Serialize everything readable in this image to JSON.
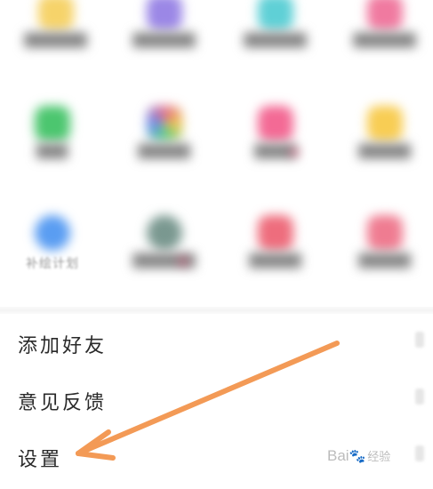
{
  "grid": {
    "tiles": [
      {
        "label": "",
        "color": "#f6d36a"
      },
      {
        "label": "",
        "color": "#9b87e6"
      },
      {
        "label": "",
        "color": "#5fd0d6"
      },
      {
        "label": "",
        "color": "#f07aa0"
      },
      {
        "label": "",
        "color": "#4cc66f"
      },
      {
        "label": "",
        "color": "#e36b8d"
      },
      {
        "label": "",
        "color": "#f36a95"
      },
      {
        "label": "",
        "color": "#f8cd54"
      },
      {
        "label": "补绘计划",
        "color": "#5a9df2"
      },
      {
        "label": "",
        "color": "#7a9890"
      },
      {
        "label": "",
        "color": "#ee6d7d"
      },
      {
        "label": "",
        "color": "#ef7c91"
      }
    ]
  },
  "menu": {
    "items": [
      {
        "label": "添加好友"
      },
      {
        "label": "意见反馈"
      },
      {
        "label": "设置"
      }
    ]
  },
  "annotation": {
    "arrow_color": "#f39a56"
  },
  "watermark": {
    "brand": "Bai",
    "paw": "🐾",
    "suffix": "经验"
  }
}
